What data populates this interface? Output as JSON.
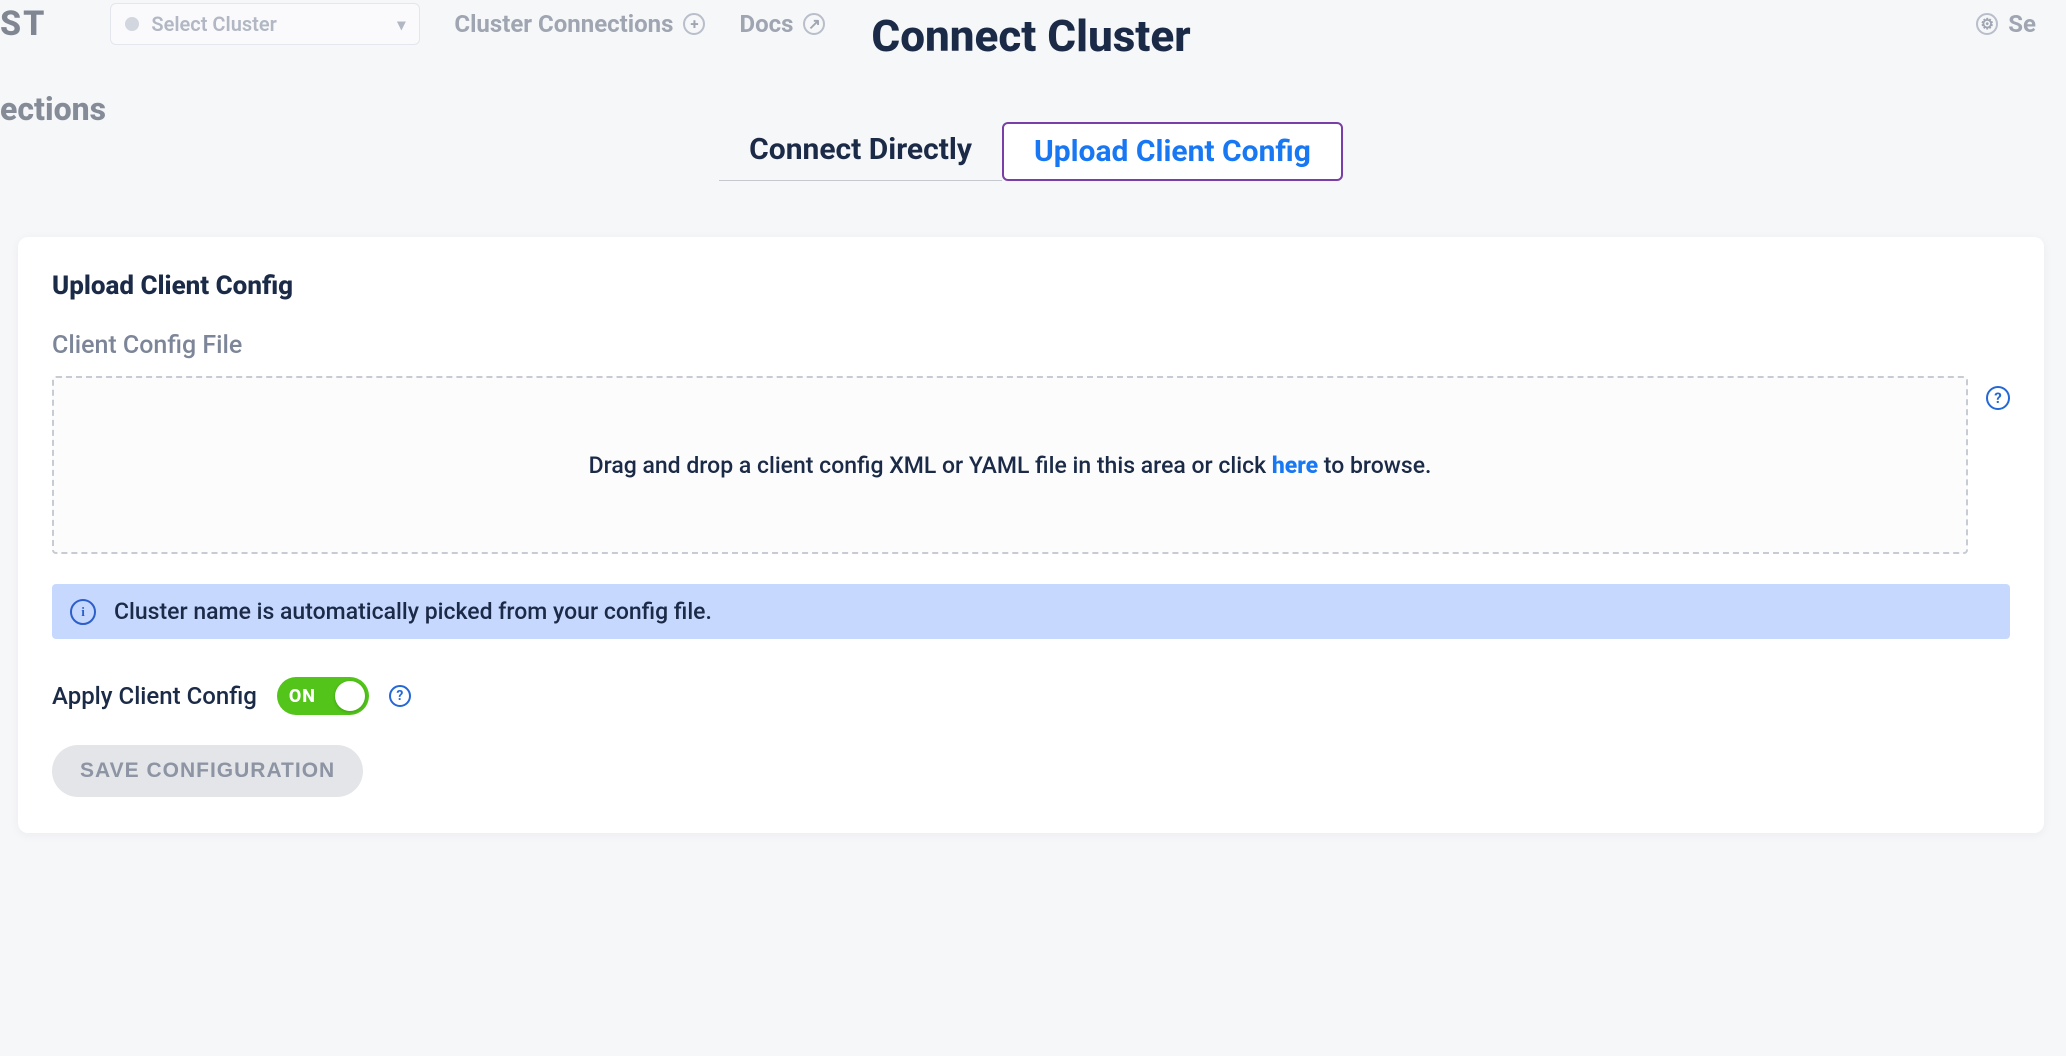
{
  "backdrop": {
    "brand_fragment": "ST",
    "select_placeholder": "Select Cluster",
    "nav_connections": "Cluster Connections",
    "nav_docs": "Docs",
    "right_fragment": "Se",
    "page_heading_fragment": "ections"
  },
  "modal": {
    "title": "Connect Cluster",
    "tabs": {
      "connect_directly": "Connect Directly",
      "upload_client_config": "Upload Client Config"
    }
  },
  "card": {
    "section_title": "Upload Client Config",
    "field_label": "Client Config File",
    "dropzone": {
      "prefix": "Drag and drop a client config XML or YAML file in this area or click ",
      "link": "here",
      "suffix": " to browse."
    },
    "info_banner": "Cluster name is automatically picked from your config file.",
    "toggle": {
      "label": "Apply Client Config",
      "state": "ON"
    },
    "save_button": "SAVE CONFIGURATION"
  }
}
